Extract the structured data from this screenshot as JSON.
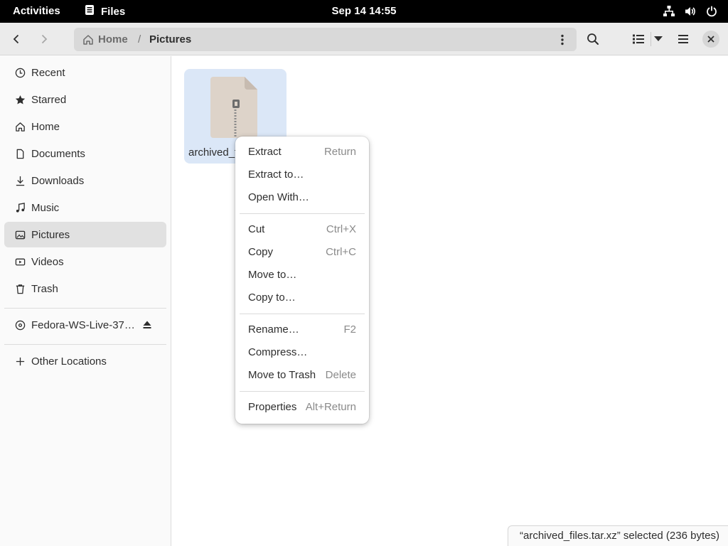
{
  "topbar": {
    "activities": "Activities",
    "app_name": "Files",
    "clock": "Sep 14  14:55"
  },
  "pathbar": {
    "home": "Home",
    "separator": "/",
    "current": "Pictures"
  },
  "sidebar": {
    "items": [
      {
        "label": "Recent",
        "icon": "clock-icon"
      },
      {
        "label": "Starred",
        "icon": "star-icon"
      },
      {
        "label": "Home",
        "icon": "home-icon"
      },
      {
        "label": "Documents",
        "icon": "document-icon"
      },
      {
        "label": "Downloads",
        "icon": "download-icon"
      },
      {
        "label": "Music",
        "icon": "music-icon"
      },
      {
        "label": "Pictures",
        "icon": "picture-icon"
      },
      {
        "label": "Videos",
        "icon": "video-icon"
      },
      {
        "label": "Trash",
        "icon": "trash-icon"
      }
    ],
    "device": {
      "label": "Fedora-WS-Live-37…",
      "icon": "disc-icon",
      "action_icon": "eject-icon"
    },
    "other": {
      "label": "Other Locations",
      "icon": "plus-icon"
    }
  },
  "file": {
    "name": "archived_files.tar.xz",
    "visible_name": "archived_f",
    "icon": "archive-icon"
  },
  "context_menu": {
    "groups": [
      [
        {
          "label": "Extract",
          "accel": "Return"
        },
        {
          "label": "Extract to…",
          "accel": ""
        },
        {
          "label": "Open With…",
          "accel": ""
        }
      ],
      [
        {
          "label": "Cut",
          "accel": "Ctrl+X"
        },
        {
          "label": "Copy",
          "accel": "Ctrl+C"
        },
        {
          "label": "Move to…",
          "accel": ""
        },
        {
          "label": "Copy to…",
          "accel": ""
        }
      ],
      [
        {
          "label": "Rename…",
          "accel": "F2"
        },
        {
          "label": "Compress…",
          "accel": ""
        },
        {
          "label": "Move to Trash",
          "accel": "Delete"
        }
      ],
      [
        {
          "label": "Properties",
          "accel": "Alt+Return"
        }
      ]
    ]
  },
  "status": {
    "text": "“archived_files.tar.xz” selected  (236 bytes)"
  },
  "colors": {
    "selection": "#dbe7f7",
    "sidebar_active": "#e1e1e1",
    "topbar": "#000000"
  }
}
